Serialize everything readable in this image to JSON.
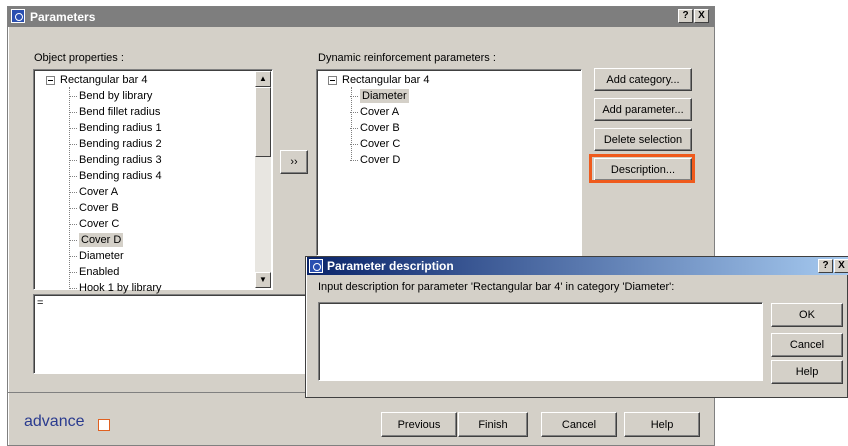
{
  "window": {
    "title": "Parameters",
    "help_btn": "?",
    "close_btn": "X"
  },
  "object_properties": {
    "label": "Object properties :",
    "root": "Rectangular bar 4",
    "items": [
      "Bend by library",
      "Bend fillet radius",
      "Bending radius 1",
      "Bending radius 2",
      "Bending radius 3",
      "Bending radius 4",
      "Cover A",
      "Cover B",
      "Cover C",
      "Cover D",
      "Diameter",
      "Enabled",
      "Hook 1 by library"
    ],
    "selected": "Cover D",
    "value_text": "="
  },
  "transfer_button": "››",
  "dynamic_params": {
    "label": "Dynamic reinforcement parameters :",
    "root": "Rectangular bar 4",
    "items": [
      "Diameter",
      "Cover A",
      "Cover B",
      "Cover C",
      "Cover D"
    ],
    "selected": "Diameter"
  },
  "side_buttons": {
    "add_category": "Add category...",
    "add_parameter": "Add parameter...",
    "delete_selection": "Delete selection",
    "description": "Description..."
  },
  "footer": {
    "brand": "advance",
    "previous": "Previous",
    "finish": "Finish",
    "cancel": "Cancel",
    "help": "Help"
  },
  "dialog": {
    "title": "Parameter description",
    "help_btn": "?",
    "close_btn": "X",
    "prompt": "Input description for parameter 'Rectangular bar 4' in category 'Diameter':",
    "input_value": "",
    "ok": "OK",
    "cancel": "Cancel",
    "help": "Help"
  },
  "colors": {
    "highlight": "#ef5a1c",
    "dialog_title": "#0a246a",
    "brand": "#2a3b8f"
  }
}
